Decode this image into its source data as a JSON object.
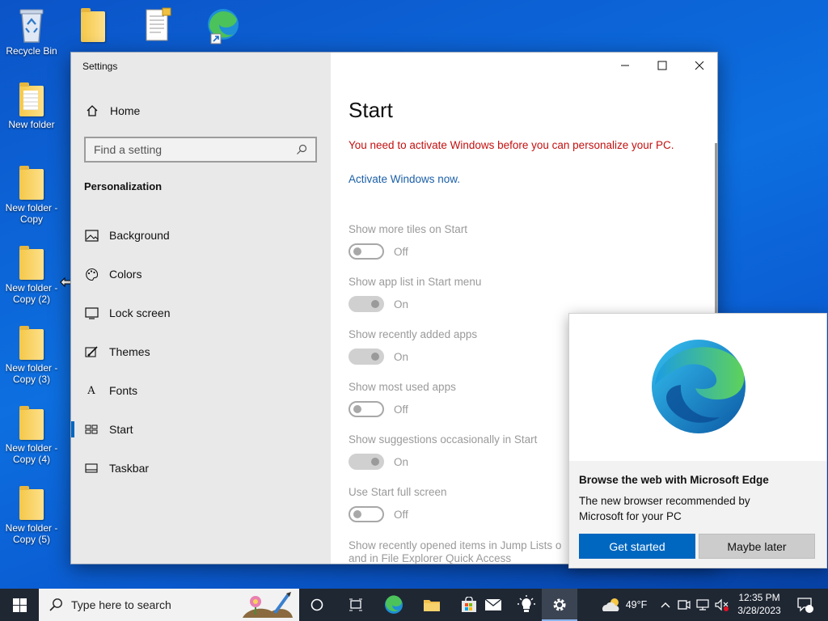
{
  "desktop": {
    "icons": [
      {
        "label": "Recycle Bin"
      },
      {
        "label": "New folder"
      },
      {
        "label": "New folder - Copy"
      },
      {
        "label": "New folder - Copy (2)"
      },
      {
        "label": "New folder - Copy (3)"
      },
      {
        "label": "New folder - Copy (4)"
      },
      {
        "label": "New folder - Copy (5)"
      }
    ]
  },
  "settings": {
    "window_title": "Settings",
    "home_label": "Home",
    "search_placeholder": "Find a setting",
    "section_label": "Personalization",
    "nav": [
      {
        "label": "Background",
        "icon": "picture-icon"
      },
      {
        "label": "Colors",
        "icon": "palette-icon"
      },
      {
        "label": "Lock screen",
        "icon": "monitor-icon"
      },
      {
        "label": "Themes",
        "icon": "brush-icon"
      },
      {
        "label": "Fonts",
        "icon": "font-icon"
      },
      {
        "label": "Start",
        "icon": "start-tiles-icon",
        "active": true
      },
      {
        "label": "Taskbar",
        "icon": "taskbar-icon"
      }
    ],
    "page_title": "Start",
    "warning": "You need to activate Windows before you can personalize your PC.",
    "activate_link": "Activate Windows now.",
    "options": [
      {
        "label": "Show more tiles on Start",
        "state": "Off"
      },
      {
        "label": "Show app list in Start menu",
        "state": "On"
      },
      {
        "label": "Show recently added apps",
        "state": "On"
      },
      {
        "label": "Show most used apps",
        "state": "Off"
      },
      {
        "label": "Show suggestions occasionally in Start",
        "state": "On"
      },
      {
        "label": "Use Start full screen",
        "state": "Off"
      }
    ],
    "truncated_option_line1": "Show recently opened items in Jump Lists o",
    "truncated_option_line2": "and in File Explorer Quick Access"
  },
  "edge_popup": {
    "heading": "Browse the web with Microsoft Edge",
    "body": "The new browser recommended by Microsoft for your PC",
    "primary_button": "Get started",
    "secondary_button": "Maybe later"
  },
  "taskbar": {
    "search_placeholder": "Type here to search",
    "weather_temp": "49°F",
    "time": "12:35 PM",
    "date": "3/28/2023",
    "notification_count": "1"
  },
  "colors": {
    "accent": "#0067c0",
    "warning": "#c41010",
    "link": "#1a5fa8",
    "taskbar": "#1f2733"
  }
}
